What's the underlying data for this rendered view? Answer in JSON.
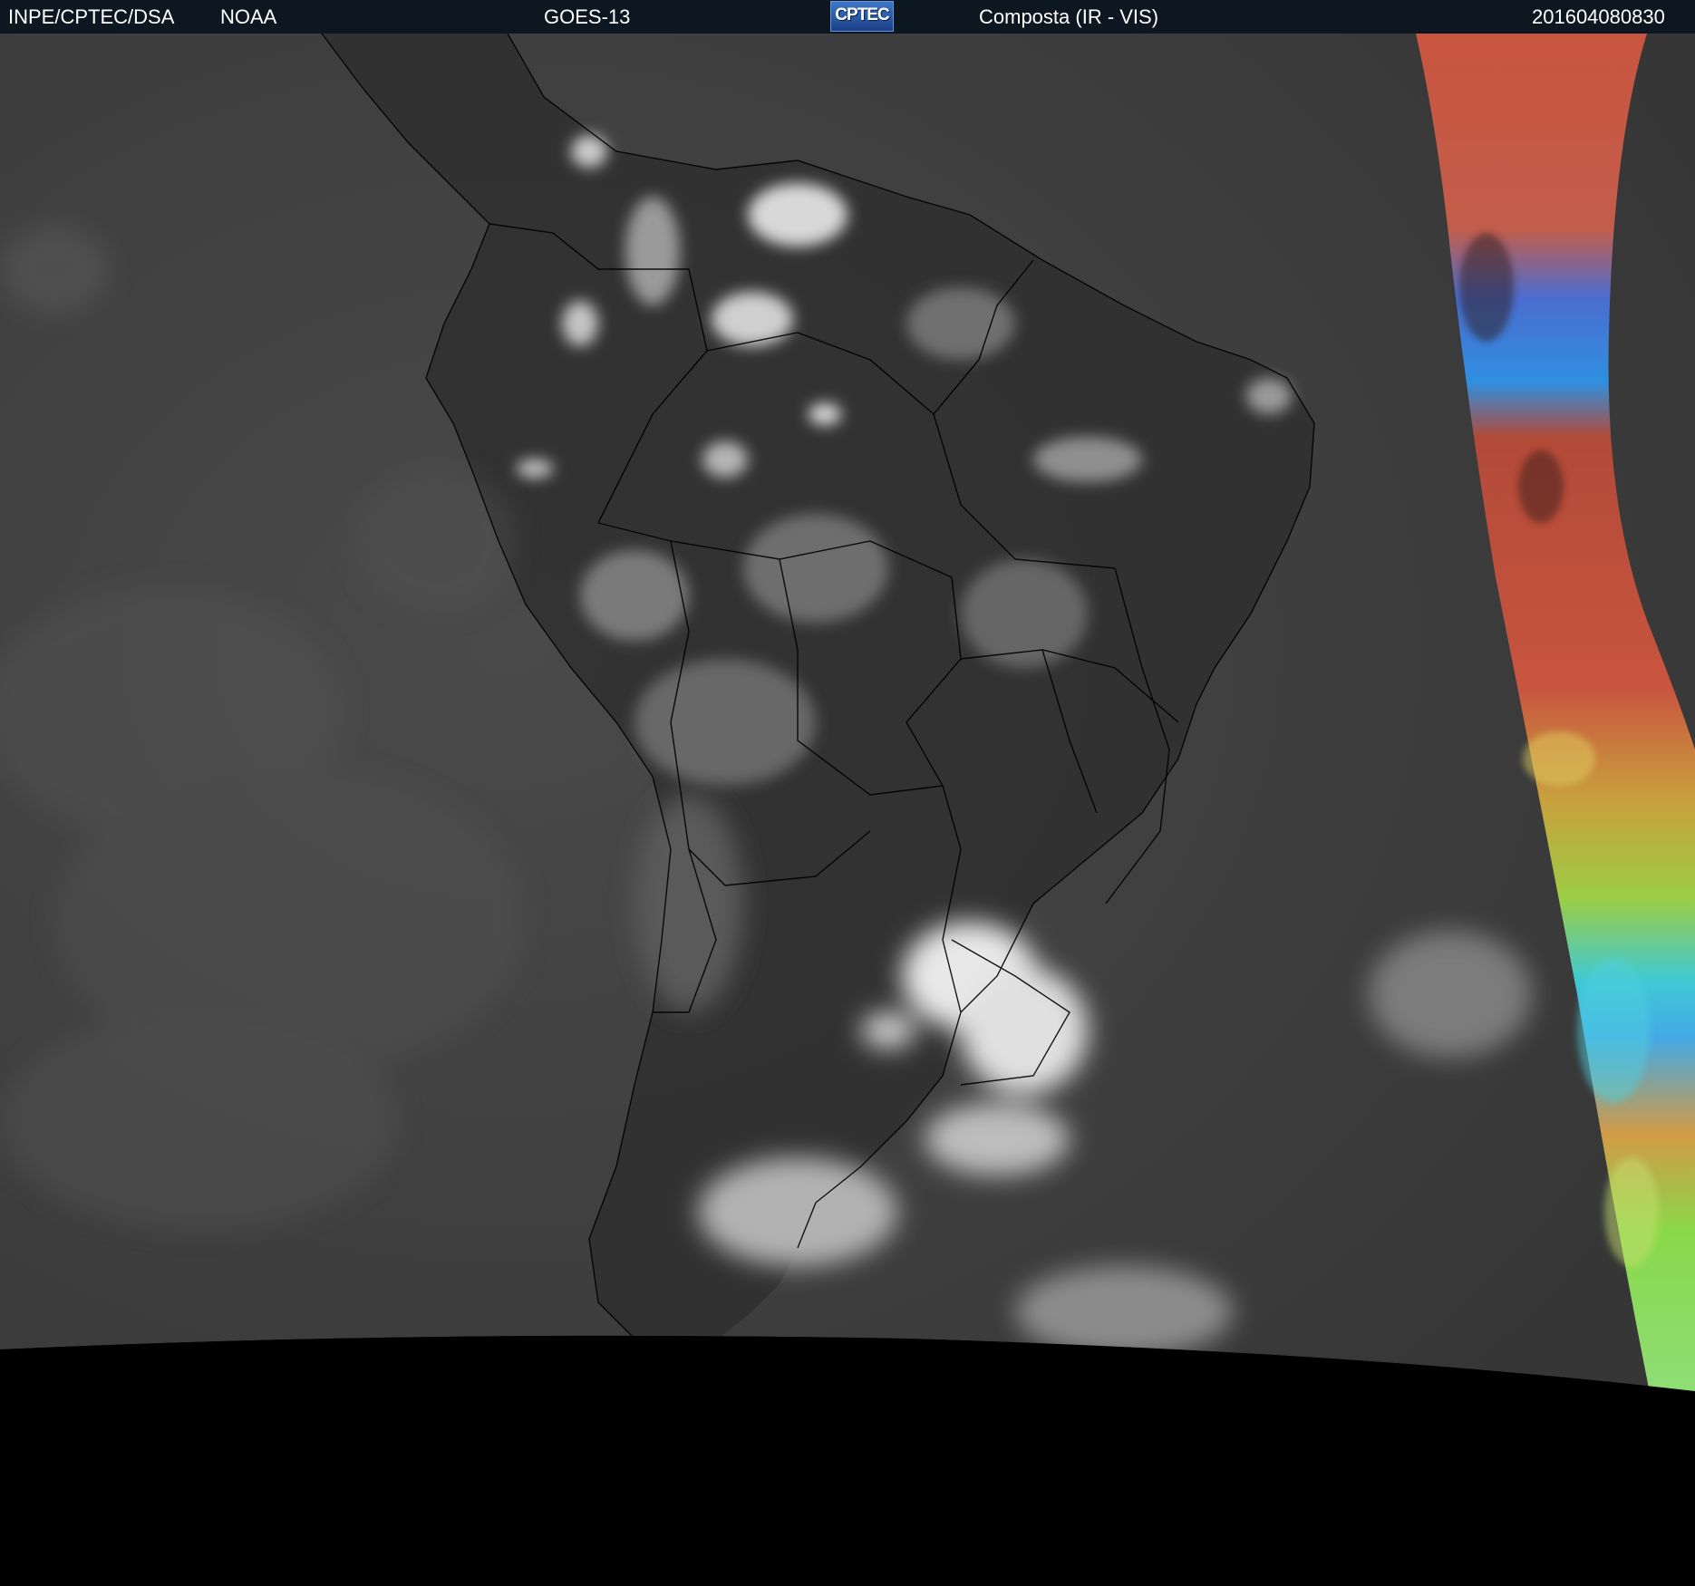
{
  "header": {
    "agency": "INPE/CPTEC/DSA",
    "partner": "NOAA",
    "satellite": "GOES-13",
    "logo_text": "CPTEC",
    "product": "Composta (IR - VIS)",
    "timestamp": "201604080830"
  },
  "colors": {
    "header_bg": "#0d1722",
    "ocean_gray": "#3e3e3e",
    "border_black": "#000000",
    "cloud_white": "#e6e6e6",
    "vis_red": "#c25a44",
    "vis_blue": "#2f8fe0",
    "vis_green": "#8ad84a"
  },
  "icons": [
    "cptec-logo-icon"
  ]
}
